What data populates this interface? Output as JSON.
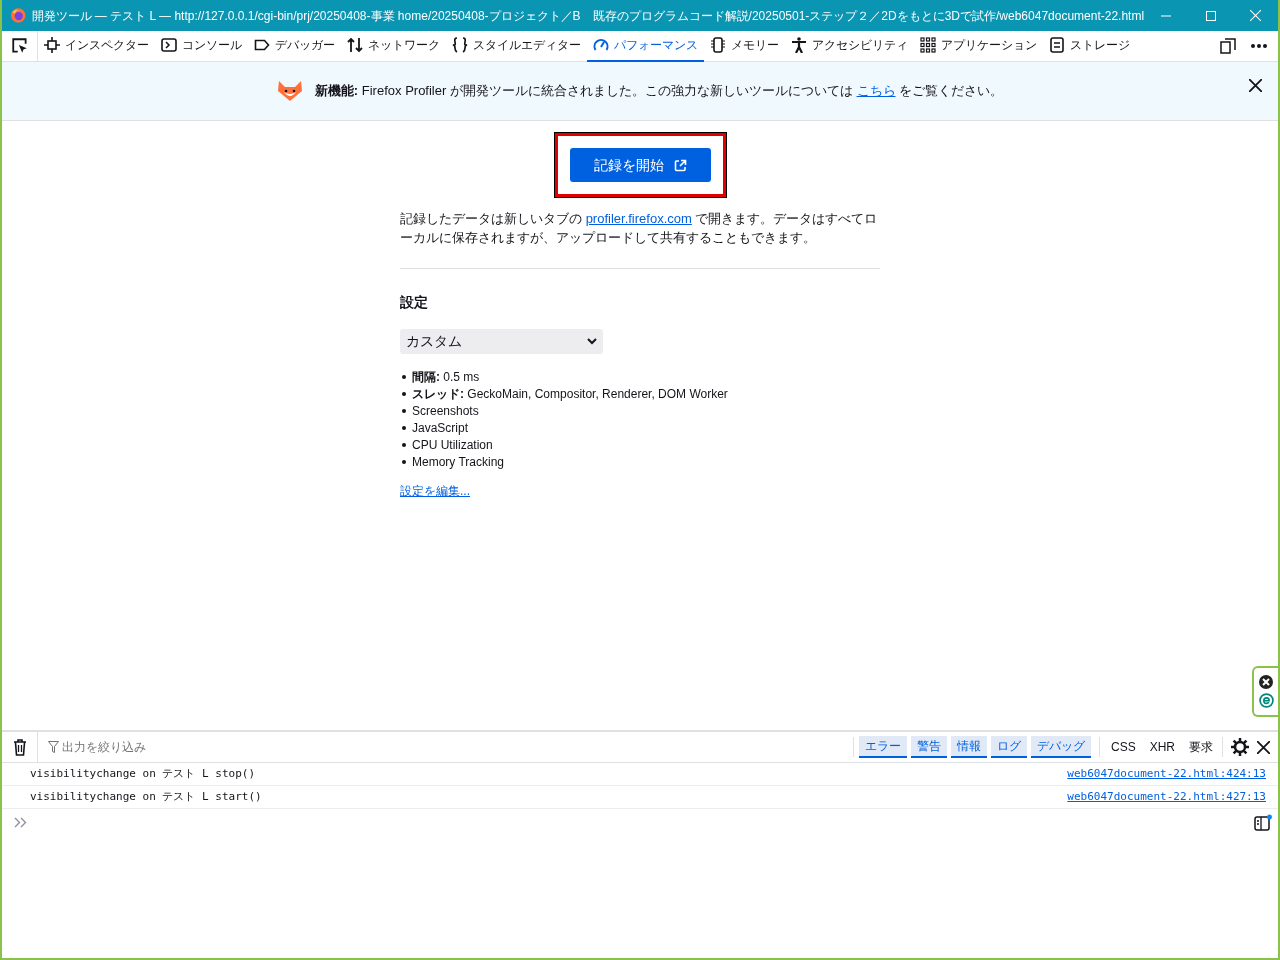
{
  "window": {
    "title": "開発ツール — テスト L — http://127.0.0.1/cgi-bin/prj/20250408-事業 home/20250408-プロジェクト／B　既存のプログラムコード解説/20250501-ステップ２／2Dをもとに3Dで試作/web6047document-22.html"
  },
  "tabs": [
    {
      "kind": "inspector",
      "label": "インスペクター",
      "selected": false
    },
    {
      "kind": "console",
      "label": "コンソール",
      "selected": false
    },
    {
      "kind": "debugger",
      "label": "デバッガー",
      "selected": false
    },
    {
      "kind": "network",
      "label": "ネットワーク",
      "selected": false
    },
    {
      "kind": "style",
      "label": "スタイルエディター",
      "selected": false
    },
    {
      "kind": "performance",
      "label": "パフォーマンス",
      "selected": true
    },
    {
      "kind": "memory",
      "label": "メモリー",
      "selected": false
    },
    {
      "kind": "accessibility",
      "label": "アクセシビリティ",
      "selected": false
    },
    {
      "kind": "application",
      "label": "アプリケーション",
      "selected": false
    },
    {
      "kind": "storage",
      "label": "ストレージ",
      "selected": false
    }
  ],
  "banner": {
    "text": "**新機能:** Firefox Profiler が開発ツールに統合されました。この強力な新しいツールについては",
    "link": "こちら",
    "after": "をご覧ください。"
  },
  "record_button": {
    "label": "記録を開始",
    "highlighted": true
  },
  "description": {
    "before": "記録したデータは新しいタブの",
    "link": "profiler.firefox.com",
    "after": "で開きます。データはすべてローカルに保存されますが、アップロードして共有することもできます。"
  },
  "settings": {
    "heading": "設定",
    "preset": "カスタム",
    "items": [
      "**間隔:** 0.5 ms",
      "**スレッド:** GeckoMain, Compositor, Renderer, DOM Worker",
      "Screenshots",
      "JavaScript",
      "CPU Utilization",
      "Memory Tracking"
    ],
    "edit_link": "設定を編集..."
  },
  "console": {
    "filter_placeholder": "出力を絞り込み",
    "levels": [
      {
        "label": "エラー",
        "selected": true
      },
      {
        "label": "警告",
        "selected": true
      },
      {
        "label": "情報",
        "selected": true
      },
      {
        "label": "ログ",
        "selected": true
      },
      {
        "label": "デバッグ",
        "selected": true
      }
    ],
    "types": [
      {
        "label": "CSS",
        "selected": false
      },
      {
        "label": "XHR",
        "selected": false
      },
      {
        "label": "要求",
        "selected": false
      }
    ],
    "messages": [
      {
        "text": "visibilitychange on テスト L stop()",
        "location": "web6047document-22.html:424:13"
      },
      {
        "text": "visibilitychange on テスト L start()",
        "location": "web6047document-22.html:427:13"
      }
    ]
  }
}
